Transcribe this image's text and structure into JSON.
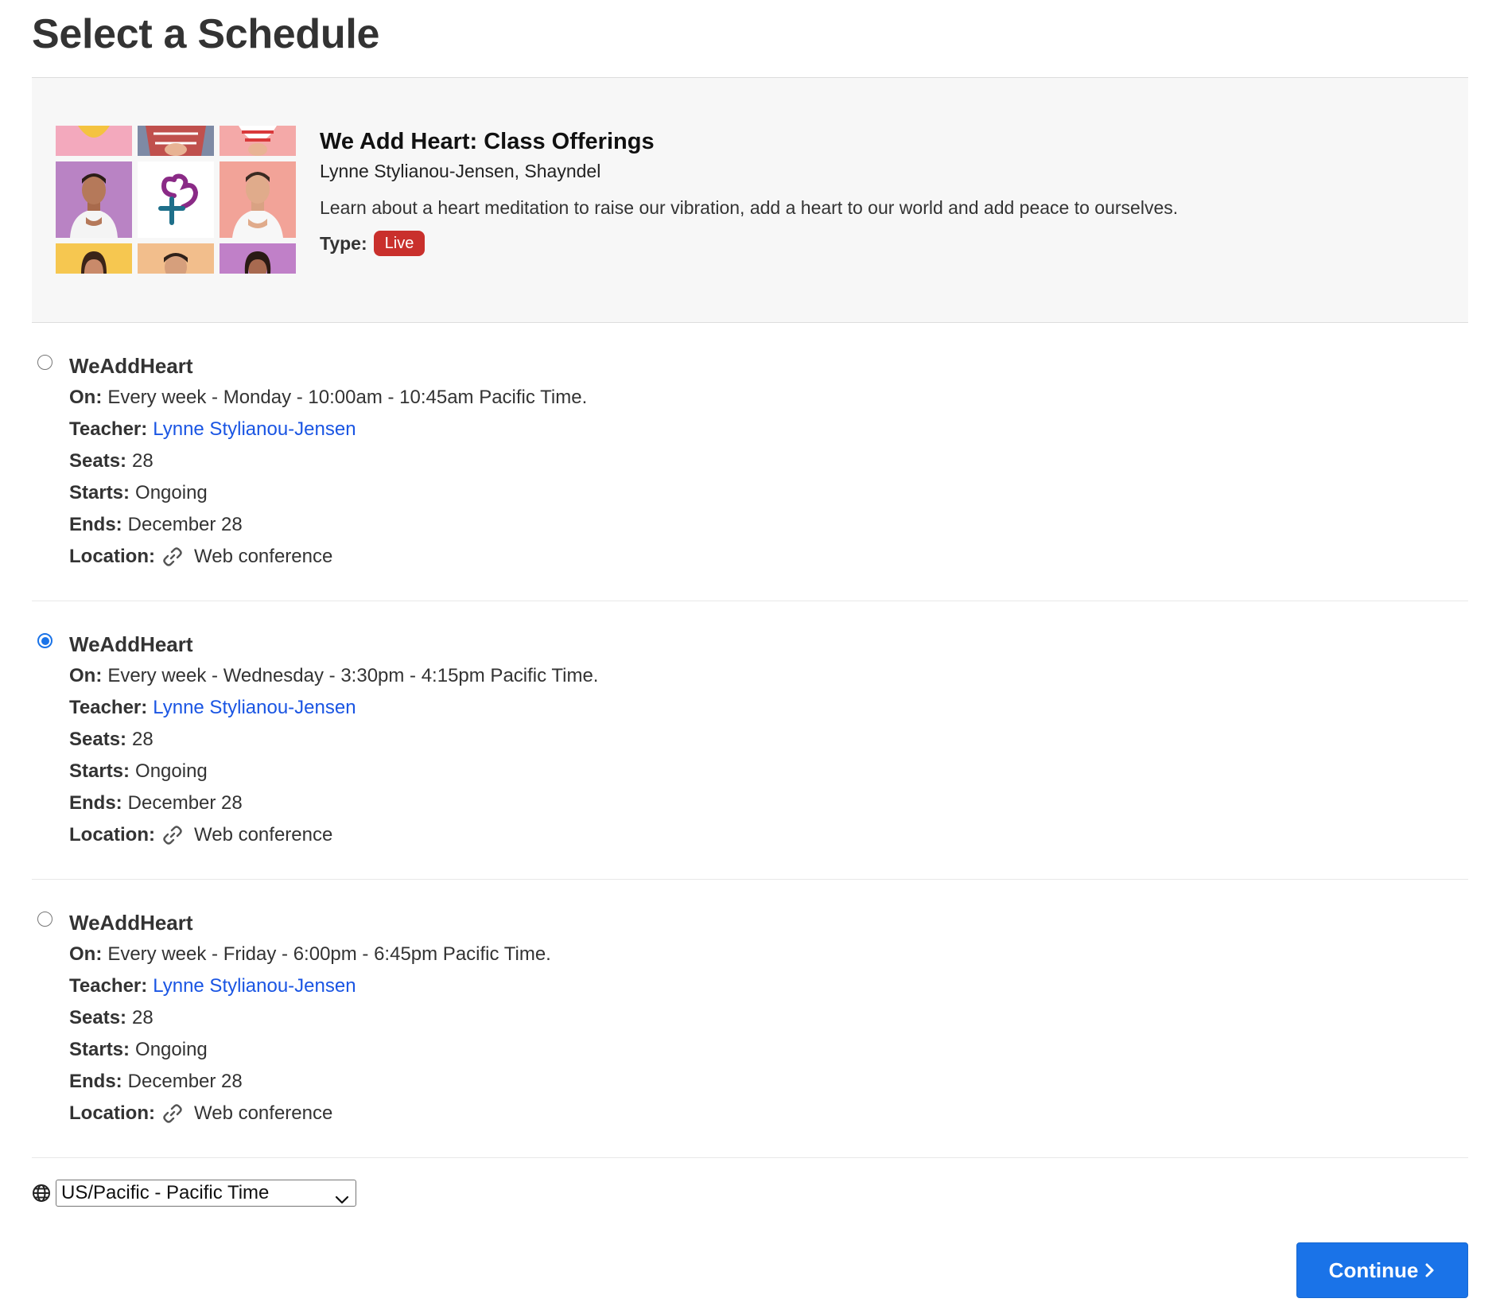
{
  "page": {
    "title": "Select a Schedule"
  },
  "class": {
    "title": "We Add Heart: Class Offerings",
    "teachers": "Lynne Stylianou-Jensen, Shayndel",
    "description": "Learn about a heart meditation to raise our vibration, add a heart to our world and add peace to ourselves.",
    "type_label": "Type:",
    "type_value": "Live",
    "badge_color": "#c9302c"
  },
  "labels": {
    "on": "On:",
    "teacher": "Teacher:",
    "seats": "Seats:",
    "starts": "Starts:",
    "ends": "Ends:",
    "location": "Location:"
  },
  "schedules": [
    {
      "name": "WeAddHeart",
      "selected": false,
      "on": "Every week - Monday - 10:00am - 10:45am Pacific Time.",
      "teacher": "Lynne Stylianou-Jensen",
      "seats": "28",
      "starts": "Ongoing",
      "ends": "December 28",
      "location": "Web conference",
      "location_icon": "link-icon"
    },
    {
      "name": "WeAddHeart",
      "selected": true,
      "on": "Every week - Wednesday - 3:30pm - 4:15pm Pacific Time.",
      "teacher": "Lynne Stylianou-Jensen",
      "seats": "28",
      "starts": "Ongoing",
      "ends": "December 28",
      "location": "Web conference",
      "location_icon": "link-icon"
    },
    {
      "name": "WeAddHeart",
      "selected": false,
      "on": "Every week - Friday - 6:00pm - 6:45pm Pacific Time.",
      "teacher": "Lynne Stylianou-Jensen",
      "seats": "28",
      "starts": "Ongoing",
      "ends": "December 28",
      "location": "Web conference",
      "location_icon": "link-icon"
    }
  ],
  "timezone": {
    "icon": "globe-icon",
    "selected": "US/Pacific - Pacific Time"
  },
  "actions": {
    "continue_label": "Continue",
    "continue_color": "#1a73e8",
    "link_color": "#1a55e3"
  }
}
